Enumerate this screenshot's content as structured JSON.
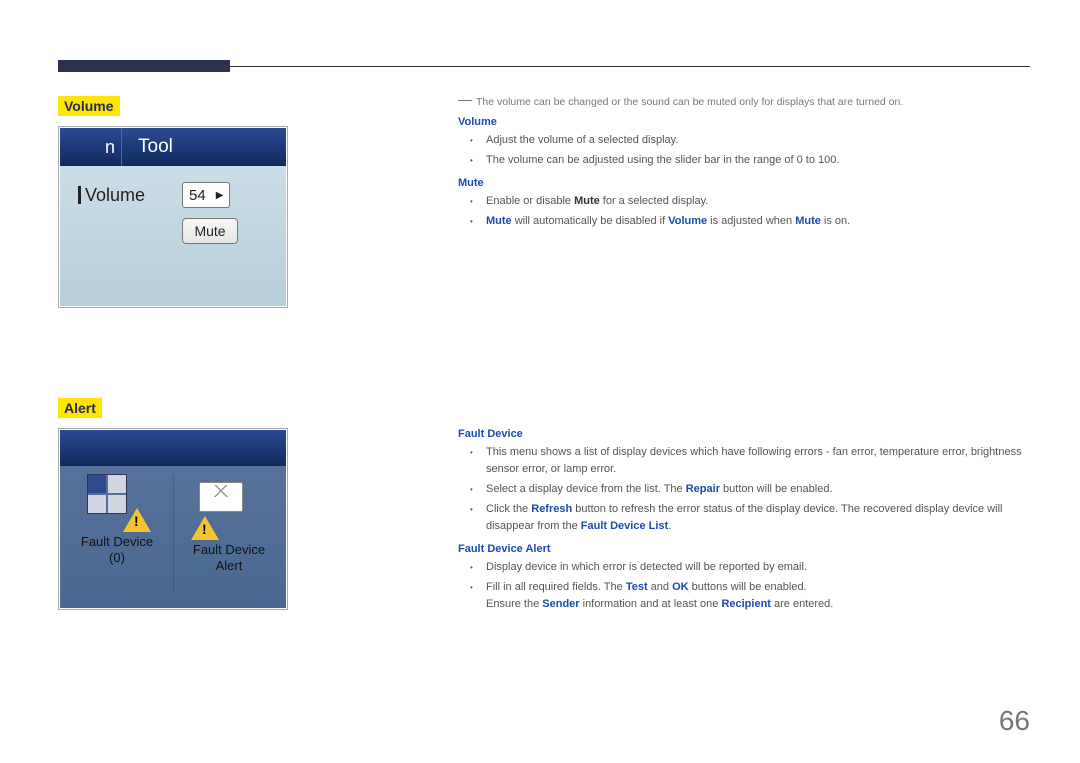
{
  "page_number": "66",
  "left": {
    "volume_heading": "Volume",
    "alert_heading": "Alert",
    "vol_shot": {
      "tab_left": "n",
      "tab_right": "Tool",
      "volume_label": "Volume",
      "volume_value": "54",
      "mute_button": "Mute"
    },
    "alert_shot": {
      "fault_device_label": "Fault Device",
      "fault_device_count": "(0)",
      "fault_device_alert_label_l1": "Fault Device",
      "fault_device_alert_label_l2": "Alert"
    }
  },
  "right": {
    "note": "The volume can be changed or the sound can be muted only for displays that are turned on.",
    "volume_heading": "Volume",
    "volume_b1": "Adjust the volume of a selected display.",
    "volume_b2": "The volume can be adjusted using the slider bar in the range of 0 to 100.",
    "mute_heading": "Mute",
    "mute_b1_pre": "Enable or disable ",
    "mute_b1_bold": "Mute",
    "mute_b1_post": " for a selected display.",
    "mute_b2_t1": "Mute",
    "mute_b2_t2": " will automatically be disabled if ",
    "mute_b2_t3": "Volume",
    "mute_b2_t4": " is adjusted when ",
    "mute_b2_t5": "Mute",
    "mute_b2_t6": " is on.",
    "fault_device_heading": "Fault Device",
    "fd_b1": "This menu shows a list of display devices which have following errors - fan error, temperature error, brightness sensor error, or lamp error.",
    "fd_b2_pre": "Select a display device from the list. The ",
    "fd_b2_bold": "Repair",
    "fd_b2_post": " button will be enabled.",
    "fd_b3_t1": "Click the ",
    "fd_b3_t2": "Refresh",
    "fd_b3_t3": " button to refresh the error status of the display device. The recovered display device will disappear from the ",
    "fd_b3_t4": "Fault Device List",
    "fd_b3_t5": ".",
    "fda_heading": "Fault Device Alert",
    "fda_b1": "Display device in which error is detected will be reported by email.",
    "fda_b2_t1": "Fill in all required fields. The ",
    "fda_b2_t2": "Test",
    "fda_b2_t3": " and ",
    "fda_b2_t4": "OK",
    "fda_b2_t5": " buttons will be enabled.",
    "fda_b3_t1": "Ensure the ",
    "fda_b3_t2": "Sender",
    "fda_b3_t3": " information and at least one ",
    "fda_b3_t4": "Recipient",
    "fda_b3_t5": " are entered."
  }
}
